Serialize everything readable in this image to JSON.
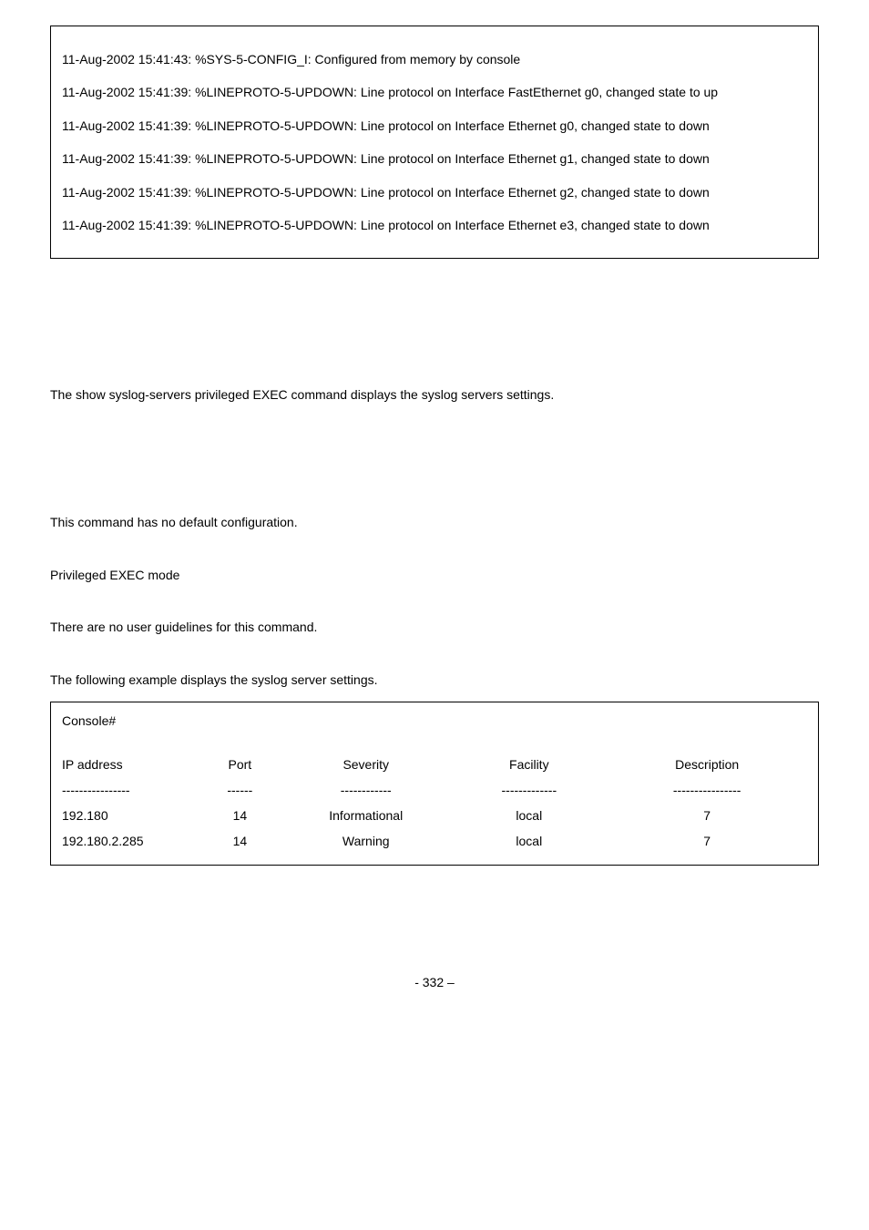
{
  "log": {
    "l1": "11-Aug-2002 15:41:43: %SYS-5-CONFIG_I: Configured from memory by console",
    "l2": "11-Aug-2002 15:41:39: %LINEPROTO-5-UPDOWN: Line protocol on Interface FastEthernet g0, changed state to up",
    "l3": "11-Aug-2002 15:41:39: %LINEPROTO-5-UPDOWN: Line protocol on Interface Ethernet g0, changed state to down",
    "l4": "11-Aug-2002 15:41:39: %LINEPROTO-5-UPDOWN: Line protocol on Interface Ethernet g1, changed state to down",
    "l5": "11-Aug-2002 15:41:39: %LINEPROTO-5-UPDOWN: Line protocol on Interface Ethernet g2, changed state to down",
    "l6": "11-Aug-2002 15:41:39: %LINEPROTO-5-UPDOWN: Line protocol on Interface Ethernet e3, changed state to down"
  },
  "text": {
    "p1": "The show syslog-servers privileged EXEC command displays the syslog servers settings.",
    "p2": "This command has no default configuration.",
    "p3": "Privileged EXEC mode",
    "p4": "There are no user guidelines for this command.",
    "p5": "The following example displays the syslog server settings."
  },
  "table": {
    "prompt": "Console#",
    "headers": {
      "ip": "IP address",
      "port": "Port",
      "severity": "Severity",
      "facility": "Facility",
      "description": "Description"
    },
    "sep": {
      "ip": "----------------",
      "port": "------",
      "severity": "------------",
      "facility": "-------------",
      "description": "----------------"
    },
    "rows": [
      {
        "ip": "192.180",
        "port": "14",
        "severity": "Informational",
        "facility": "local",
        "description": "7"
      },
      {
        "ip": "192.180.2.285",
        "port": "14",
        "severity": "Warning",
        "facility": "local",
        "description": "7"
      }
    ]
  },
  "footer": "- 332 –"
}
